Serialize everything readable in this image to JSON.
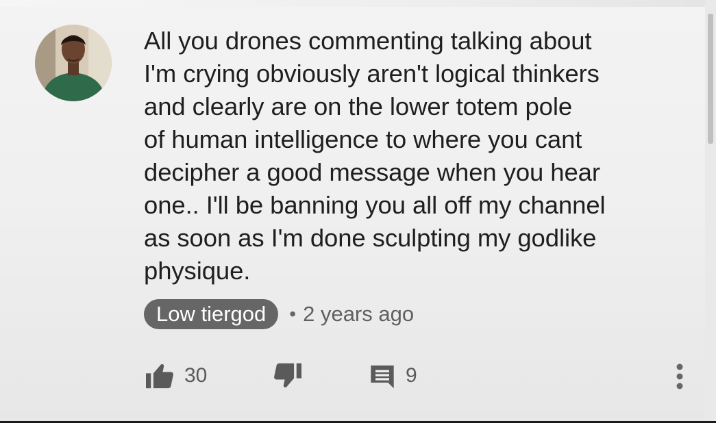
{
  "comment": {
    "avatar_icon": "user-avatar",
    "text_lines": [
      "All you drones commenting talking about",
      "I'm crying obviously aren't logical thinkers",
      "and clearly are on the lower totem pole",
      "of human intelligence to where you cant",
      "decipher a good message when you hear",
      "one.. I'll be banning you all off my channel",
      "as soon as I'm done sculpting my godlike",
      "physique."
    ],
    "author": "Low tiergod",
    "separator": "•",
    "timestamp": "2 years ago",
    "actions": {
      "like_icon": "thumb-up-icon",
      "like_count": "30",
      "dislike_icon": "thumb-down-icon",
      "reply_icon": "comment-icon",
      "reply_count": "9",
      "more_icon": "more-vertical-icon"
    }
  },
  "colors": {
    "text": "#1f1f1f",
    "author_pill_bg": "#666666",
    "author_pill_text": "#ffffff",
    "meta_text": "#5f5f5f",
    "icon": "#5a5a5a",
    "background": "#f0f0f0"
  }
}
